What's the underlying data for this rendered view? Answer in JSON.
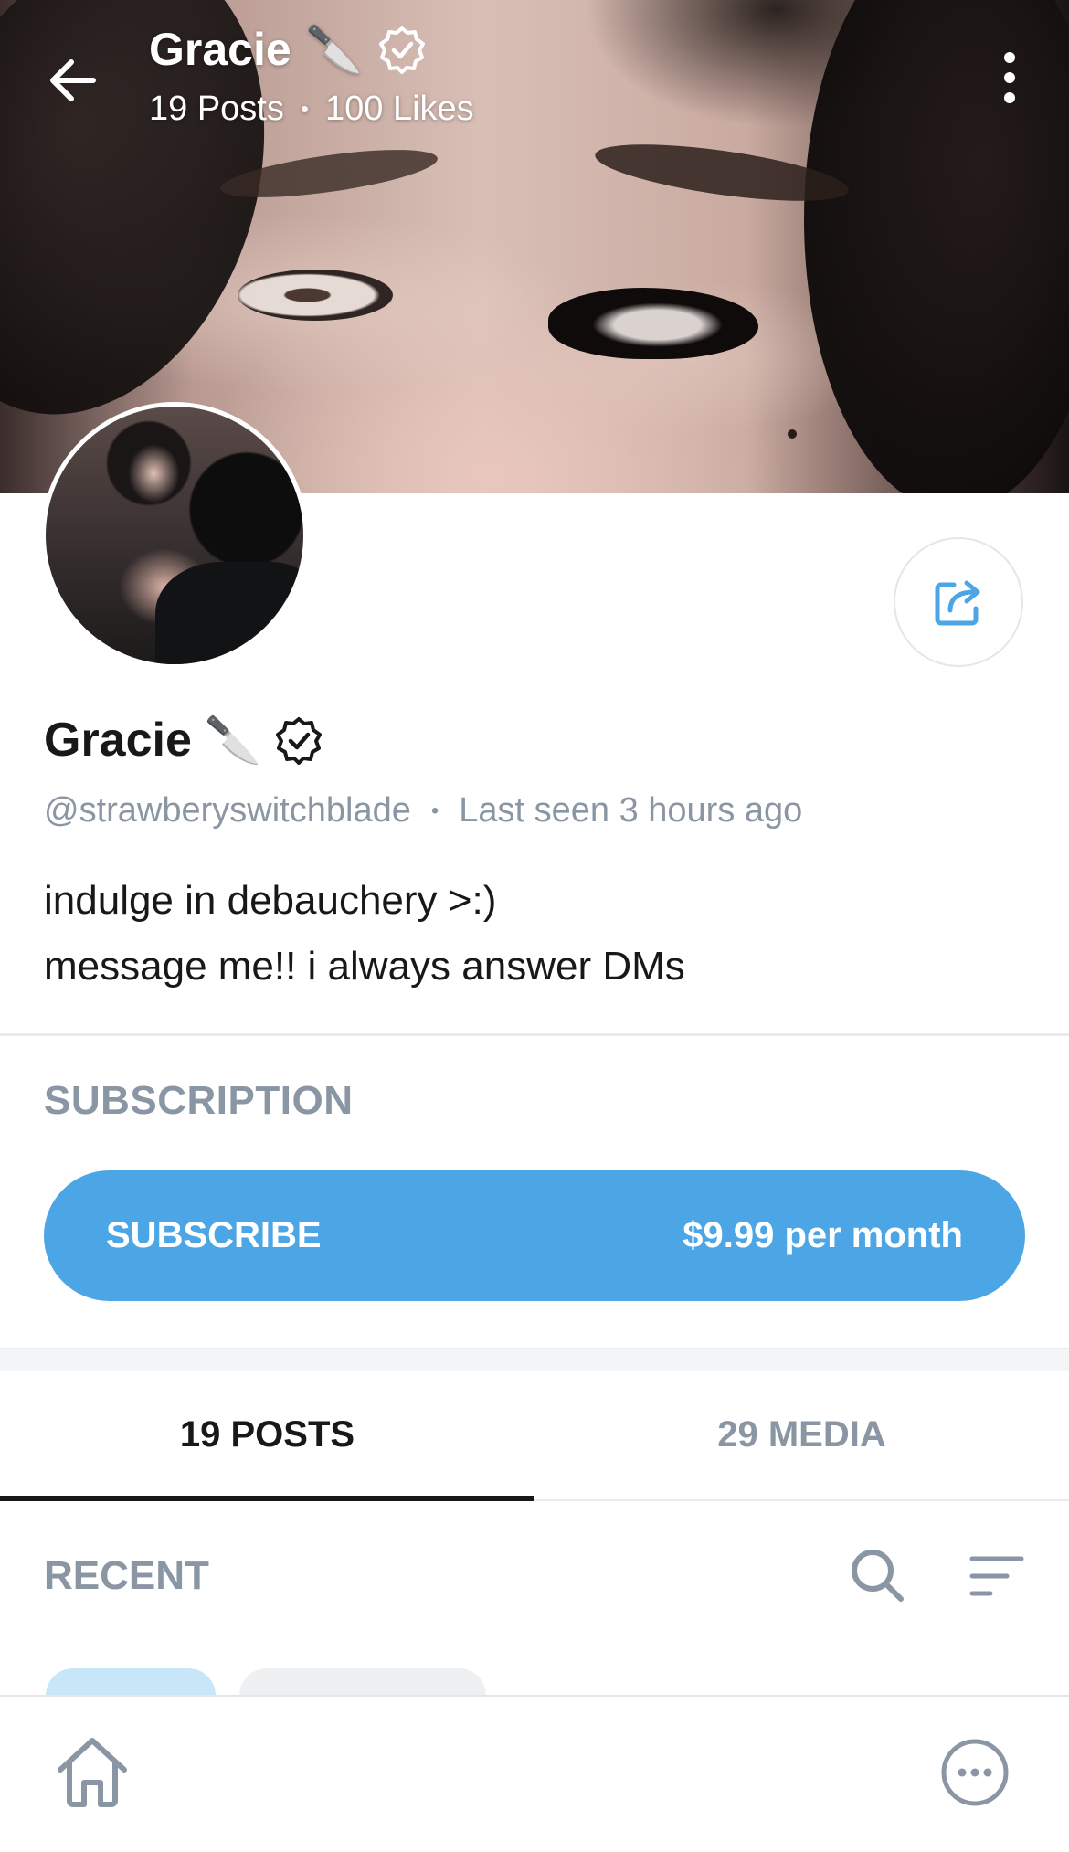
{
  "header": {
    "title": "Gracie",
    "title_emoji": "🔪",
    "posts": "19 Posts",
    "separator": "•",
    "likes": "100 Likes"
  },
  "profile": {
    "name": "Gracie",
    "name_emoji": "🔪",
    "handle": "@strawberyswitchblade",
    "separator": "•",
    "last_seen": "Last seen 3 hours ago",
    "bio": [
      "indulge in debauchery >:)",
      "message me!! i always answer DMs"
    ]
  },
  "subscription": {
    "section_title": "SUBSCRIPTION",
    "button_label": "SUBSCRIBE",
    "price": "$9.99 per month"
  },
  "tabs": [
    {
      "label": "19 POSTS",
      "active": true
    },
    {
      "label": "29 MEDIA",
      "active": false
    }
  ],
  "feed": {
    "section_title": "RECENT"
  },
  "icons": {
    "back": "arrow-left-icon",
    "menu": "kebab-menu-icon",
    "verified": "verified-badge-icon",
    "share": "share-icon",
    "search": "search-icon",
    "sort": "sort-icon",
    "home": "home-icon",
    "more": "more-icon"
  },
  "colors": {
    "accent": "#4ca6e6",
    "muted_text": "#8a96a3",
    "primary_text": "#16181a"
  }
}
